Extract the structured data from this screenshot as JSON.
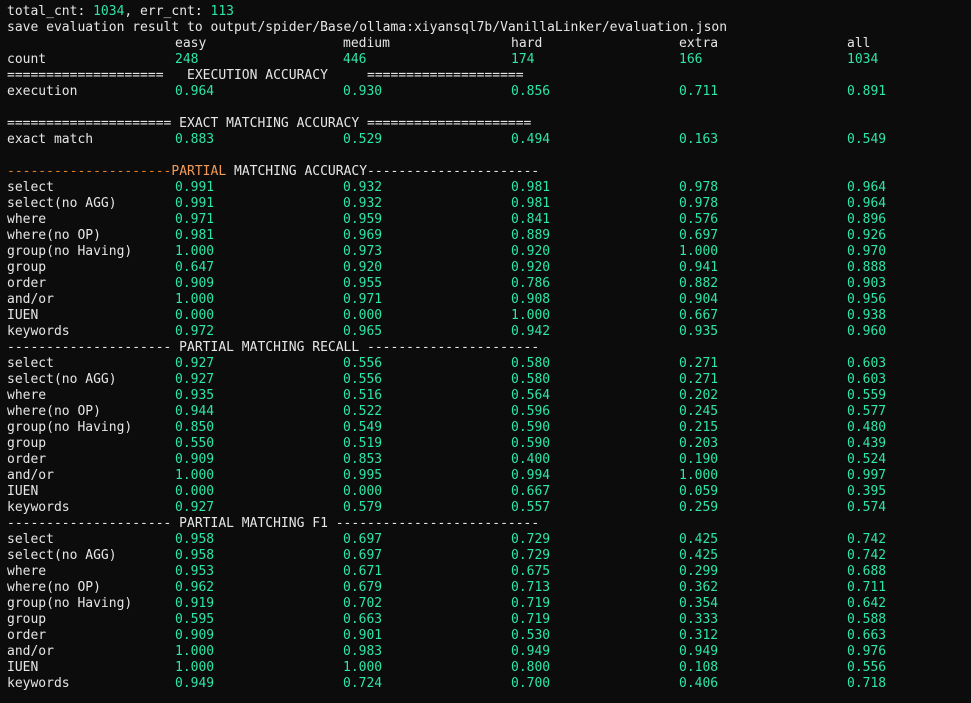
{
  "stats": {
    "total_label": "total_cnt: ",
    "total_value": "1034",
    "err_label": ", err_cnt: ",
    "err_value": "113"
  },
  "save_line": "save evaluation result to output/spider/Base/ollama:xiyansql7b/VanillaLinker/evaluation.json",
  "levels": [
    "easy",
    "medium",
    "hard",
    "extra",
    "all"
  ],
  "count": {
    "label": "count",
    "values": [
      "248",
      "446",
      "174",
      "166",
      "1034"
    ]
  },
  "headers": {
    "execution": "====================   EXECUTION ACCURACY     ====================",
    "exact": "===================== EXACT MATCHING ACCURACY =====================",
    "partial_acc_left": "---------------------",
    "partial_acc_highlight": "PARTIAL",
    "partial_acc_right": " MATCHING ACCURACY----------------------",
    "recall": "--------------------- PARTIAL MATCHING RECALL ----------------------",
    "f1": "--------------------- PARTIAL MATCHING F1 --------------------------"
  },
  "execution_rows": [
    {
      "label": "execution",
      "values": [
        "0.964",
        "0.930",
        "0.856",
        "0.711",
        "0.891"
      ]
    }
  ],
  "exact_rows": [
    {
      "label": "exact match",
      "values": [
        "0.883",
        "0.529",
        "0.494",
        "0.163",
        "0.549"
      ]
    }
  ],
  "partial_accuracy": [
    {
      "label": "select",
      "values": [
        "0.991",
        "0.932",
        "0.981",
        "0.978",
        "0.964"
      ]
    },
    {
      "label": "select(no AGG)",
      "values": [
        "0.991",
        "0.932",
        "0.981",
        "0.978",
        "0.964"
      ]
    },
    {
      "label": "where",
      "values": [
        "0.971",
        "0.959",
        "0.841",
        "0.576",
        "0.896"
      ]
    },
    {
      "label": "where(no OP)",
      "values": [
        "0.981",
        "0.969",
        "0.889",
        "0.697",
        "0.926"
      ]
    },
    {
      "label": "group(no Having)",
      "values": [
        "1.000",
        "0.973",
        "0.920",
        "1.000",
        "0.970"
      ]
    },
    {
      "label": "group",
      "values": [
        "0.647",
        "0.920",
        "0.920",
        "0.941",
        "0.888"
      ]
    },
    {
      "label": "order",
      "values": [
        "0.909",
        "0.955",
        "0.786",
        "0.882",
        "0.903"
      ]
    },
    {
      "label": "and/or",
      "values": [
        "1.000",
        "0.971",
        "0.908",
        "0.904",
        "0.956"
      ]
    },
    {
      "label": "IUEN",
      "values": [
        "0.000",
        "0.000",
        "1.000",
        "0.667",
        "0.938"
      ]
    },
    {
      "label": "keywords",
      "values": [
        "0.972",
        "0.965",
        "0.942",
        "0.935",
        "0.960"
      ]
    }
  ],
  "partial_recall": [
    {
      "label": "select",
      "values": [
        "0.927",
        "0.556",
        "0.580",
        "0.271",
        "0.603"
      ]
    },
    {
      "label": "select(no AGG)",
      "values": [
        "0.927",
        "0.556",
        "0.580",
        "0.271",
        "0.603"
      ]
    },
    {
      "label": "where",
      "values": [
        "0.935",
        "0.516",
        "0.564",
        "0.202",
        "0.559"
      ]
    },
    {
      "label": "where(no OP)",
      "values": [
        "0.944",
        "0.522",
        "0.596",
        "0.245",
        "0.577"
      ]
    },
    {
      "label": "group(no Having)",
      "values": [
        "0.850",
        "0.549",
        "0.590",
        "0.215",
        "0.480"
      ]
    },
    {
      "label": "group",
      "values": [
        "0.550",
        "0.519",
        "0.590",
        "0.203",
        "0.439"
      ]
    },
    {
      "label": "order",
      "values": [
        "0.909",
        "0.853",
        "0.400",
        "0.190",
        "0.524"
      ]
    },
    {
      "label": "and/or",
      "values": [
        "1.000",
        "0.995",
        "0.994",
        "1.000",
        "0.997"
      ]
    },
    {
      "label": "IUEN",
      "values": [
        "0.000",
        "0.000",
        "0.667",
        "0.059",
        "0.395"
      ]
    },
    {
      "label": "keywords",
      "values": [
        "0.927",
        "0.579",
        "0.557",
        "0.259",
        "0.574"
      ]
    }
  ],
  "partial_f1": [
    {
      "label": "select",
      "values": [
        "0.958",
        "0.697",
        "0.729",
        "0.425",
        "0.742"
      ]
    },
    {
      "label": "select(no AGG)",
      "values": [
        "0.958",
        "0.697",
        "0.729",
        "0.425",
        "0.742"
      ]
    },
    {
      "label": "where",
      "values": [
        "0.953",
        "0.671",
        "0.675",
        "0.299",
        "0.688"
      ]
    },
    {
      "label": "where(no OP)",
      "values": [
        "0.962",
        "0.679",
        "0.713",
        "0.362",
        "0.711"
      ]
    },
    {
      "label": "group(no Having)",
      "values": [
        "0.919",
        "0.702",
        "0.719",
        "0.354",
        "0.642"
      ]
    },
    {
      "label": "group",
      "values": [
        "0.595",
        "0.663",
        "0.719",
        "0.333",
        "0.588"
      ]
    },
    {
      "label": "order",
      "values": [
        "0.909",
        "0.901",
        "0.530",
        "0.312",
        "0.663"
      ]
    },
    {
      "label": "and/or",
      "values": [
        "1.000",
        "0.983",
        "0.949",
        "0.949",
        "0.976"
      ]
    },
    {
      "label": "IUEN",
      "values": [
        "1.000",
        "1.000",
        "0.800",
        "0.108",
        "0.556"
      ]
    },
    {
      "label": "keywords",
      "values": [
        "0.949",
        "0.724",
        "0.700",
        "0.406",
        "0.718"
      ]
    }
  ],
  "colors": {
    "background": "#0c0c0c",
    "text": "#e6e6e6",
    "number": "#2ee6a6",
    "dash": "#e67e22",
    "highlight": "#f39c5a"
  }
}
